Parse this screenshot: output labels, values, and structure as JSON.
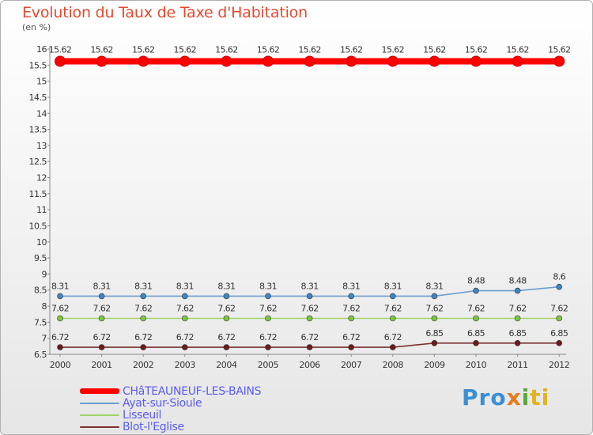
{
  "chart_data": {
    "type": "line",
    "title": "Evolution du Taux de Taxe d'Habitation",
    "unit_label": "(en %)",
    "x": [
      "2000",
      "2001",
      "2002",
      "2003",
      "2004",
      "2005",
      "2006",
      "2007",
      "2008",
      "2009",
      "2010",
      "2011",
      "2012"
    ],
    "ylim": [
      6.5,
      16
    ],
    "yticks": [
      "6.5",
      "7",
      "7.5",
      "8",
      "8.5",
      "9",
      "9.5",
      "10",
      "10.5",
      "11",
      "11.5",
      "12",
      "12.5",
      "13",
      "13.5",
      "14",
      "14.5",
      "15",
      "15.5",
      "16"
    ],
    "grid": false,
    "legend_position": "bottom-left",
    "series": [
      {
        "name": "CHâTEAUNEUF-LES-BAINS",
        "color": "#ff0000",
        "marker": "#ff0000",
        "values": [
          15.62,
          15.62,
          15.62,
          15.62,
          15.62,
          15.62,
          15.62,
          15.62,
          15.62,
          15.62,
          15.62,
          15.62,
          15.62
        ],
        "labels": [
          "15.62",
          "15.62",
          "15.62",
          "15.62",
          "15.62",
          "15.62",
          "15.62",
          "15.62",
          "15.62",
          "15.62",
          "15.62",
          "15.62",
          "15.62"
        ]
      },
      {
        "name": "Ayat-sur-Sioule",
        "color": "#6a9fcf",
        "marker": "#3f86c4",
        "values": [
          8.31,
          8.31,
          8.31,
          8.31,
          8.31,
          8.31,
          8.31,
          8.31,
          8.31,
          8.31,
          8.48,
          8.48,
          8.6
        ],
        "labels": [
          "8.31",
          "8.31",
          "8.31",
          "8.31",
          "8.31",
          "8.31",
          "8.31",
          "8.31",
          "8.31",
          "8.31",
          "8.48",
          "8.48",
          "8.6"
        ]
      },
      {
        "name": "Lisseuil",
        "color": "#9ed46a",
        "marker": "#7cc642",
        "values": [
          7.62,
          7.62,
          7.62,
          7.62,
          7.62,
          7.62,
          7.62,
          7.62,
          7.62,
          7.62,
          7.62,
          7.62,
          7.62
        ],
        "labels": [
          "7.62",
          "7.62",
          "7.62",
          "7.62",
          "7.62",
          "7.62",
          "7.62",
          "7.62",
          "7.62",
          "7.62",
          "7.62",
          "7.62",
          "7.62"
        ]
      },
      {
        "name": "Blot-l'Eglise",
        "color": "#7a3030",
        "marker": "#6b1c1c",
        "values": [
          6.72,
          6.72,
          6.72,
          6.72,
          6.72,
          6.72,
          6.72,
          6.72,
          6.72,
          6.85,
          6.85,
          6.85,
          6.85
        ],
        "labels": [
          "6.72",
          "6.72",
          "6.72",
          "6.72",
          "6.72",
          "6.72",
          "6.72",
          "6.72",
          "6.72",
          "6.85",
          "6.85",
          "6.85",
          "6.85"
        ]
      }
    ]
  },
  "brand": {
    "p1": "Pro",
    "p2": "x",
    "p3": "i",
    "p4": "ti"
  }
}
